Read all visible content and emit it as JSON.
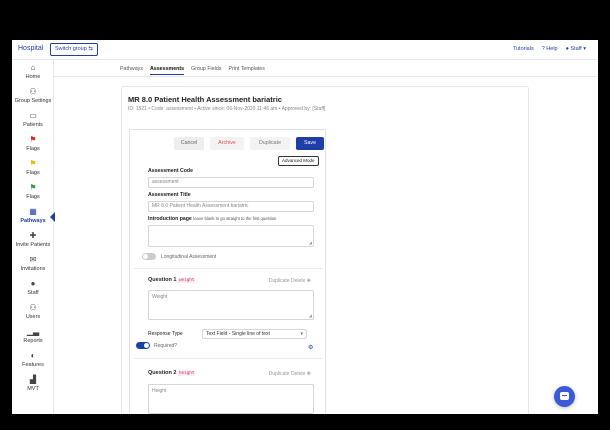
{
  "navbar": {
    "brand": "Hospital",
    "switch_group": "Switch group ⇆",
    "tutorials": "Tutorials",
    "help": "? Help",
    "user": "Staff ▾"
  },
  "sidebar": {
    "items": [
      {
        "label": "Home",
        "icon": "home-icon",
        "glyph": "⌂"
      },
      {
        "label": "Group Settings",
        "icon": "group-icon",
        "glyph": "⚇"
      },
      {
        "label": "Patients",
        "icon": "bed-icon",
        "glyph": "▭"
      },
      {
        "label": "Flags",
        "icon": "red-flag-icon",
        "glyph": "⚑",
        "color": "#d93025"
      },
      {
        "label": "Flags",
        "icon": "yellow-flag-icon",
        "glyph": "⚑",
        "color": "#f4b400"
      },
      {
        "label": "Flags",
        "icon": "green-flag-icon",
        "glyph": "⚑",
        "color": "#2ea043"
      },
      {
        "label": "Pathways",
        "icon": "pathways-icon",
        "glyph": "▦"
      },
      {
        "label": "Invite Patients",
        "icon": "invite-icon",
        "glyph": "✚"
      },
      {
        "label": "Invitations",
        "icon": "envelope-icon",
        "glyph": "✉"
      },
      {
        "label": "Staff",
        "icon": "staff-icon",
        "glyph": "●"
      },
      {
        "label": "Users",
        "icon": "users-icon",
        "glyph": "⚇"
      },
      {
        "label": "Reports",
        "icon": "reports-icon",
        "glyph": "▁▃"
      },
      {
        "label": "Features",
        "icon": "toggle-icon",
        "glyph": "◐"
      },
      {
        "label": "MVT",
        "icon": "chart-icon",
        "glyph": "▟"
      }
    ]
  },
  "tabs": [
    "Pathways",
    "Assessments",
    "Group Fields",
    "Print Templates"
  ],
  "card": {
    "title": "MR 8.0 Patient Health Assessment bariatric",
    "meta": "ID: 1521 • Code: assessment • Active since: 06-Nov-2020 11:46 am • Approved by: [Staff]"
  },
  "buttons": {
    "cancel": "Cancel",
    "archive": "Archive",
    "duplicate": "Duplicate",
    "save": "Save",
    "advanced": "Advanced Mode"
  },
  "form": {
    "code_label": "Assessment Code",
    "code_value": "assessment",
    "title_label": "Assessment Title",
    "title_value": "MR 8.0 Patient Health Assessment bariatric",
    "intro_label": "Introduction page",
    "intro_hint": "leave blank to go straight to the first question",
    "longitudinal_label": "Longitudinal Assessment"
  },
  "questions": [
    {
      "heading": "Question 1",
      "code": "weight",
      "actions": "Duplicate  Delete ✥",
      "value": "Weight",
      "response_type_label": "Response Type",
      "response_type": "Text Field - Single line of text",
      "required_label": "Required?"
    },
    {
      "heading": "Question 2",
      "code": "height",
      "actions": "Duplicate  Delete ✥",
      "value": "Height"
    }
  ],
  "colors": {
    "accent": "#1f3fa8",
    "archive": "#d9534f",
    "code_tag": "#d6336c"
  }
}
